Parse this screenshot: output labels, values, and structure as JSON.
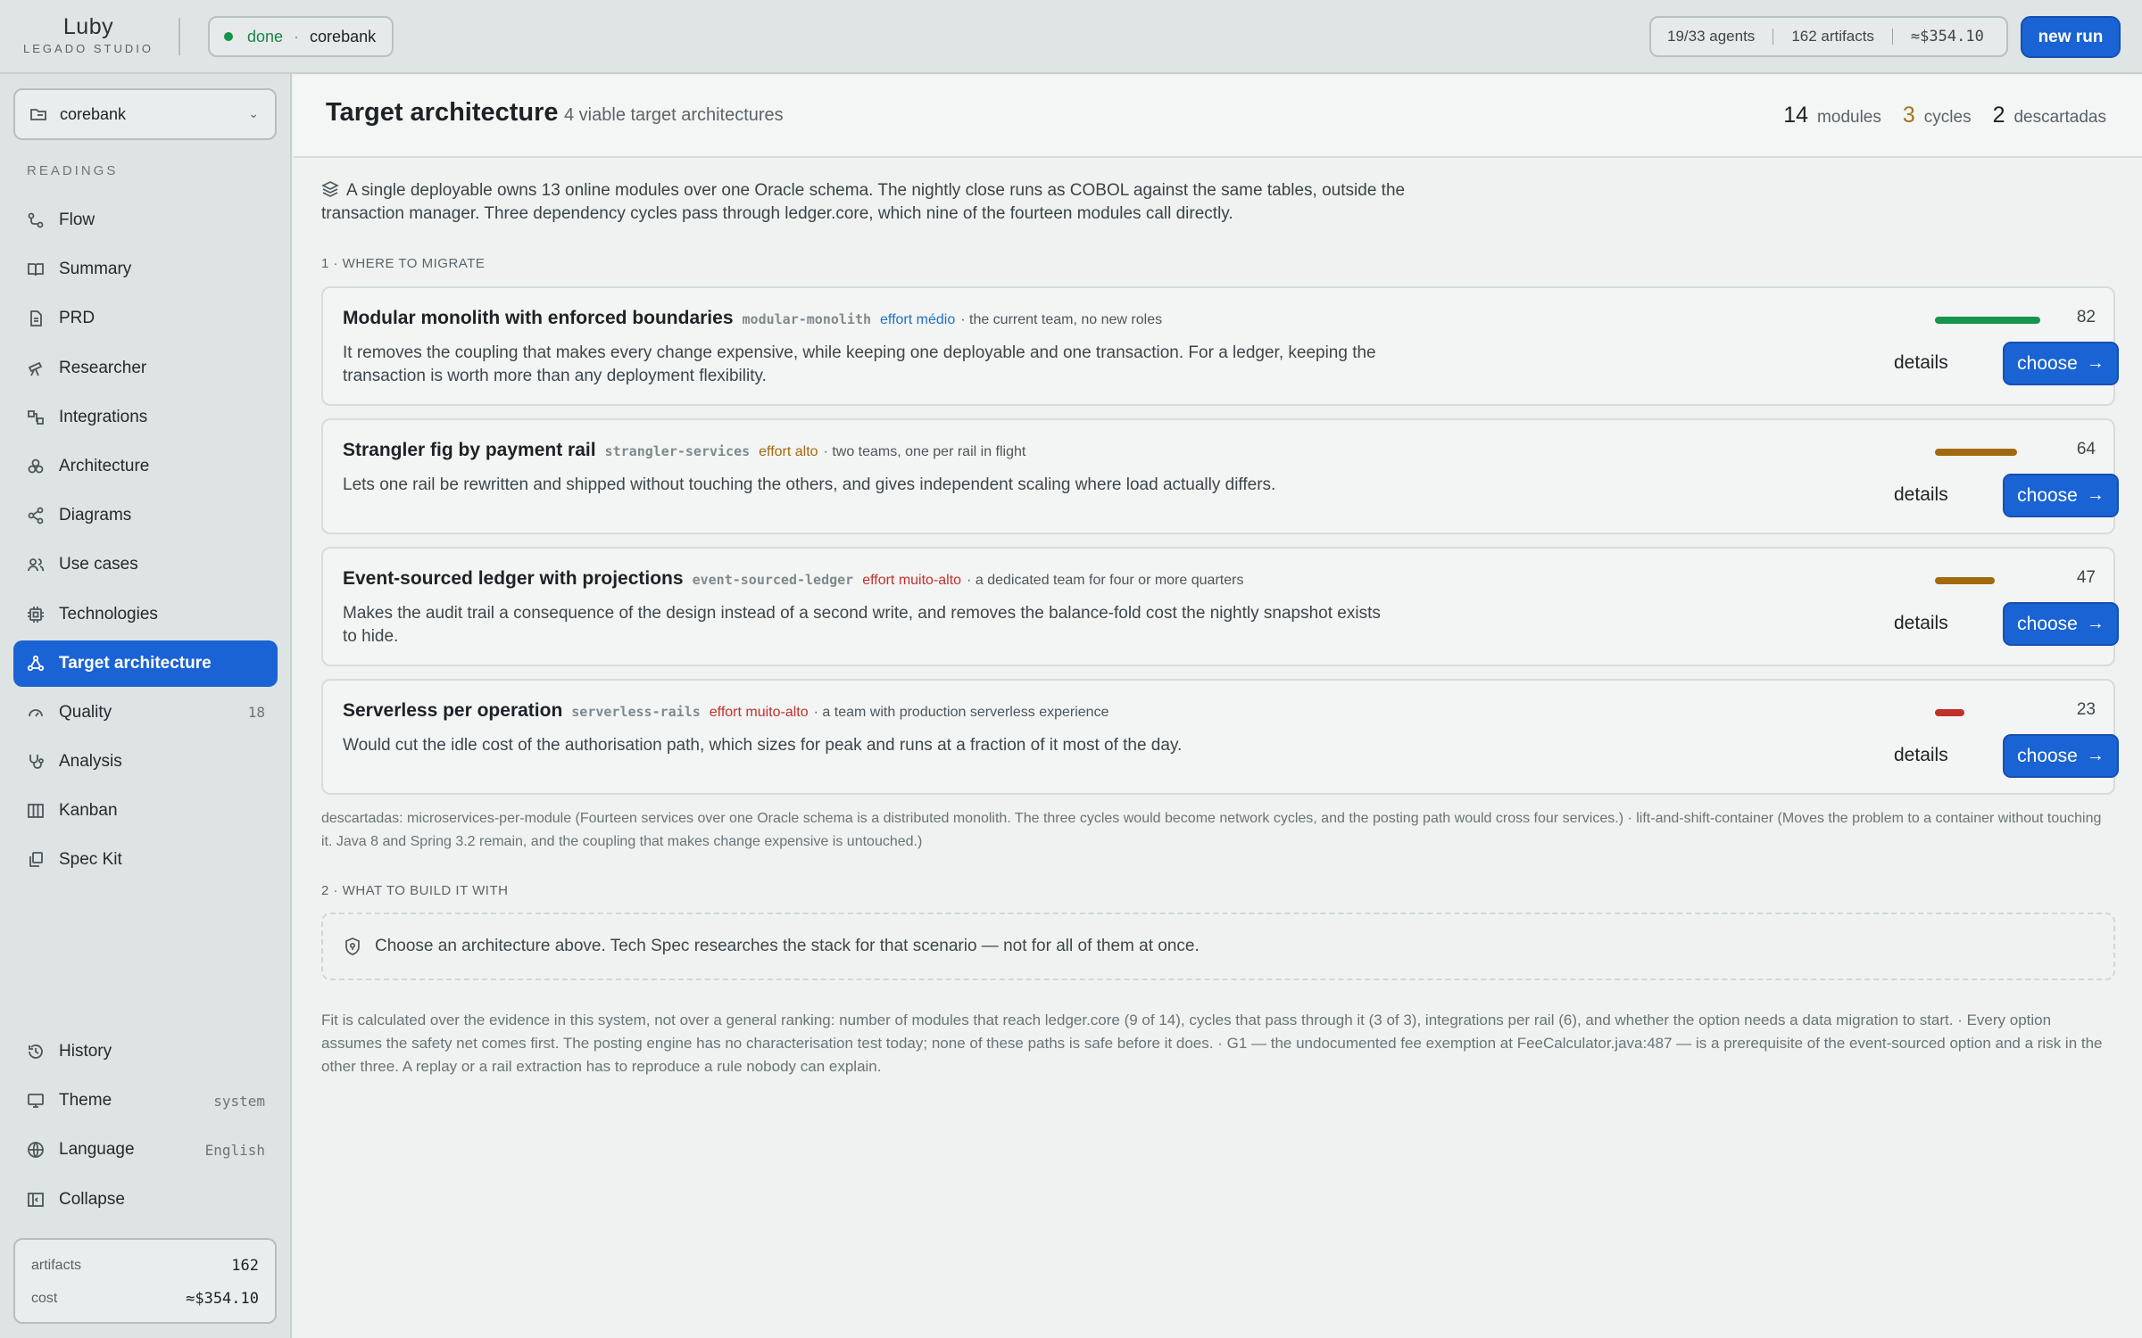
{
  "app": {
    "logo": "Luby",
    "studio": "LEGADO STUDIO",
    "status": "done",
    "project": "corebank",
    "stats": {
      "agents": "19/33 agents",
      "artifacts": "162 artifacts",
      "cost": "≈$354.10"
    },
    "new_run": "new run"
  },
  "sidebar": {
    "project_select": "corebank",
    "section_label": "READINGS",
    "items": [
      {
        "label": "Flow",
        "icon": "flow-icon"
      },
      {
        "label": "Summary",
        "icon": "book-icon"
      },
      {
        "label": "PRD",
        "icon": "document-icon"
      },
      {
        "label": "Researcher",
        "icon": "telescope-icon"
      },
      {
        "label": "Integrations",
        "icon": "integrations-icon"
      },
      {
        "label": "Architecture",
        "icon": "boxes-icon"
      },
      {
        "label": "Diagrams",
        "icon": "share-icon"
      },
      {
        "label": "Use cases",
        "icon": "users-icon"
      },
      {
        "label": "Technologies",
        "icon": "chip-icon"
      },
      {
        "label": "Target architecture",
        "icon": "target-arch-icon",
        "active": true
      },
      {
        "label": "Quality",
        "icon": "gauge-icon",
        "badge": "18"
      },
      {
        "label": "Analysis",
        "icon": "stethoscope-icon"
      },
      {
        "label": "Kanban",
        "icon": "kanban-icon"
      },
      {
        "label": "Spec Kit",
        "icon": "spec-kit-icon"
      }
    ],
    "bottom": [
      {
        "label": "History",
        "icon": "history-icon",
        "meta": ""
      },
      {
        "label": "Theme",
        "icon": "monitor-icon",
        "meta": "system"
      },
      {
        "label": "Language",
        "icon": "globe-icon",
        "meta": "English"
      },
      {
        "label": "Collapse",
        "icon": "collapse-icon",
        "meta": ""
      }
    ],
    "footer": {
      "artifacts_label": "artifacts",
      "artifacts_value": "162",
      "cost_label": "cost",
      "cost_value": "≈$354.10"
    }
  },
  "main": {
    "title": "Target architecture",
    "subtitle": "4 viable target architectures",
    "head_stats": [
      {
        "num": "14",
        "label": "modules",
        "color": "#1c2226"
      },
      {
        "num": "3",
        "label": "cycles",
        "color": "#a3741a"
      },
      {
        "num": "2",
        "label": "descartadas",
        "color": "#1c2226"
      }
    ],
    "intro": "A single deployable owns 13 online modules over one Oracle schema. The nightly close runs as COBOL against the same tables, outside the transaction manager. Three dependency cycles pass through ledger.core, which nine of the fourteen modules call directly.",
    "section1": "1 · WHERE TO MIGRATE",
    "options": [
      {
        "title": "Modular monolith with enforced boundaries",
        "tag": "modular-monolith",
        "effort": "effort médio",
        "effort_color": "#1f6fc9",
        "team": "· the current team, no new roles",
        "desc": "It removes the coupling that makes every change expensive, while keeping one deployable and one transaction. For a ledger, keeping the transaction is worth more than any deployment flexibility.",
        "score": "82",
        "score_fraction": 0.82,
        "bar_color": "#17954e",
        "details": "details",
        "choose": "choose"
      },
      {
        "title": "Strangler fig by payment rail",
        "tag": "strangler-services",
        "effort": "effort alto",
        "effort_color": "#a3690f",
        "team": "· two teams, one per rail in flight",
        "desc": "Lets one rail be rewritten and shipped without touching the others, and gives independent scaling where load actually differs.",
        "score": "64",
        "score_fraction": 0.64,
        "bar_color": "#a3690f",
        "details": "details",
        "choose": "choose"
      },
      {
        "title": "Event-sourced ledger with projections",
        "tag": "event-sourced-ledger",
        "effort": "effort muito-alto",
        "effort_color": "#c0312b",
        "team": "· a dedicated team for four or more quarters",
        "desc": "Makes the audit trail a consequence of the design instead of a second write, and removes the balance-fold cost the nightly snapshot exists to hide.",
        "score": "47",
        "score_fraction": 0.47,
        "bar_color": "#a3690f",
        "details": "details",
        "choose": "choose"
      },
      {
        "title": "Serverless per operation",
        "tag": "serverless-rails",
        "effort": "effort muito-alto",
        "effort_color": "#c0312b",
        "team": "· a team with production serverless experience",
        "desc": "Would cut the idle cost of the authorisation path, which sizes for peak and runs at a fraction of it most of the day.",
        "score": "23",
        "score_fraction": 0.23,
        "bar_color": "#c0312b",
        "details": "details",
        "choose": "choose"
      }
    ],
    "discarded": "descartadas: microservices-per-module (Fourteen services over one Oracle schema is a distributed monolith. The three cycles would become network cycles, and the posting path would cross four services.) · lift-and-shift-container (Moves the problem to a container without touching it. Java 8 and Spring 3.2 remain, and the coupling that makes change expensive is untouched.)",
    "section2": "2 · WHAT TO BUILD IT WITH",
    "build_hint": "Choose an architecture above. Tech Spec researches the stack for that scenario — not for all of them at once.",
    "footnote": "Fit is calculated over the evidence in this system, not over a general ranking: number of modules that reach ledger.core (9 of 14), cycles that pass through it (3 of 3), integrations per rail (6), and whether the option needs a data migration to start. · Every option assumes the safety net comes first. The posting engine has no characterisation test today; none of these paths is safe before it does. · G1 — the undocumented fee exemption at FeeCalculator.java:487 — is a prerequisite of the event-sourced option and a risk in the other three. A replay or a rail extraction has to reproduce a rule nobody can explain."
  }
}
